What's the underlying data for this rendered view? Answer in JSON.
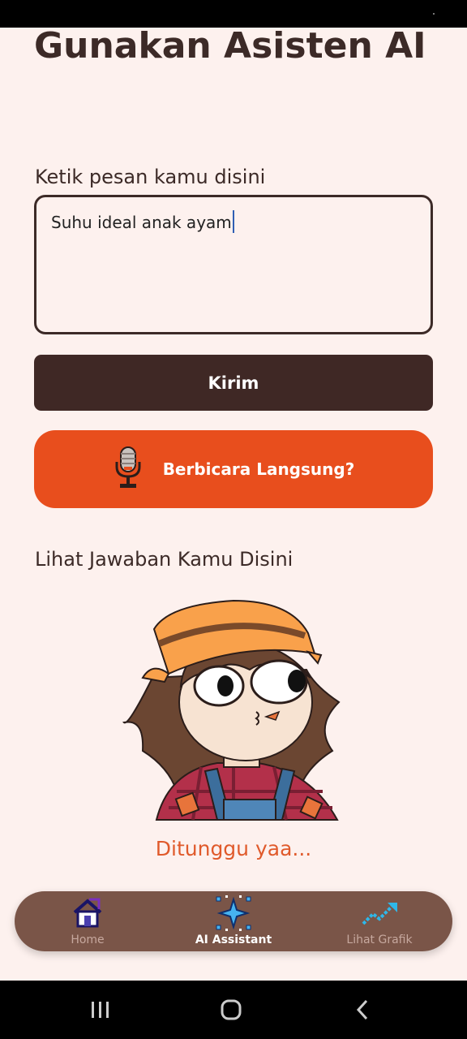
{
  "page": {
    "title": "Gunakan Asisten AI",
    "input_label": "Ketik pesan kamu disini",
    "input_value": "Suhu ideal anak ayam",
    "send_label": "Kirim",
    "voice_label": "Berbicara Langsung?",
    "voice_icon": "microphone-icon",
    "answer_label": "Lihat Jawaban Kamu Disini",
    "waiting_text": "Ditunggu yaa..."
  },
  "bottom_nav": {
    "items": [
      {
        "label": "Home",
        "icon": "home-icon",
        "active": false
      },
      {
        "label": "AI Assistant",
        "icon": "sparkle-icon",
        "active": true
      },
      {
        "label": "Lihat Grafik",
        "icon": "chart-trend-icon",
        "active": false
      }
    ]
  },
  "system_nav": {
    "icons": [
      "recent-apps-icon",
      "home-button-icon",
      "back-icon"
    ]
  },
  "colors": {
    "background": "#fdf1ee",
    "primary_dark": "#3f2825",
    "accent_orange": "#e84e1d",
    "nav_bar": "#7a5548",
    "waiting_text": "#e05a2b"
  }
}
